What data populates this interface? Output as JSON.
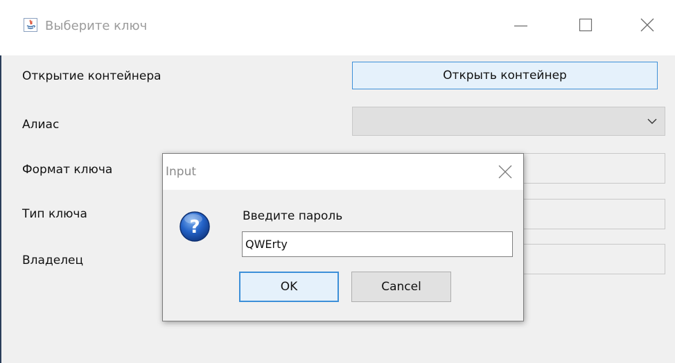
{
  "window": {
    "title": "Выберите ключ",
    "icons": {
      "app": "java-app-icon",
      "minimize": "minimize-icon",
      "maximize": "maximize-icon",
      "close": "close-icon"
    }
  },
  "form": {
    "open_container_label": "Открытие контейнера",
    "open_container_button": "Открыть контейнер",
    "alias_label": "Алиас",
    "alias_value": "",
    "key_format_label": "Формат ключа",
    "key_type_label": "Тип ключа",
    "owner_label": "Владелец"
  },
  "dialog": {
    "title": "Input",
    "prompt": "Введите пароль",
    "input_value": "QWErty",
    "ok_label": "OK",
    "cancel_label": "Cancel",
    "icon": "question-icon"
  },
  "colors": {
    "accent": "#3c8fd8",
    "button_focus_bg": "#e5f1fb",
    "window_bg": "#f0f0f0",
    "title_gray": "#9b9b9b"
  }
}
